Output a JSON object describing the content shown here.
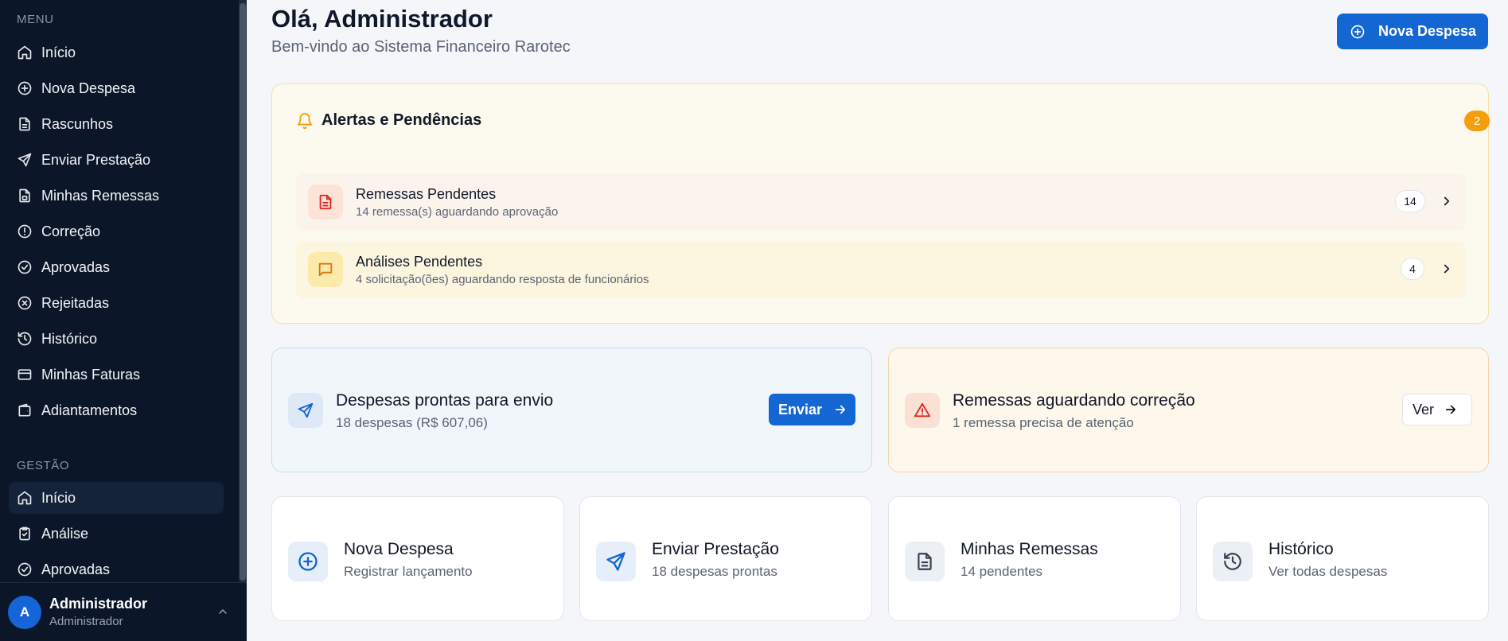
{
  "sidebar": {
    "menu_title": "MENU",
    "menu_items": [
      {
        "label": "Início",
        "icon": "home-icon"
      },
      {
        "label": "Nova Despesa",
        "icon": "plus-circle-icon"
      },
      {
        "label": "Rascunhos",
        "icon": "document-icon"
      },
      {
        "label": "Enviar Prestação",
        "icon": "send-icon"
      },
      {
        "label": "Minhas Remessas",
        "icon": "file-lock-icon"
      },
      {
        "label": "Correção",
        "icon": "alert-circle-icon"
      },
      {
        "label": "Aprovadas",
        "icon": "check-circle-icon"
      },
      {
        "label": "Rejeitadas",
        "icon": "x-circle-icon"
      },
      {
        "label": "Histórico",
        "icon": "history-icon"
      },
      {
        "label": "Minhas Faturas",
        "icon": "credit-card-icon"
      },
      {
        "label": "Adiantamentos",
        "icon": "wallet-icon"
      }
    ],
    "gestao_title": "GESTÃO",
    "gestao_items": [
      {
        "label": "Início",
        "icon": "home-icon",
        "active": true
      },
      {
        "label": "Análise",
        "icon": "clipboard-check-icon"
      },
      {
        "label": "Aprovadas",
        "icon": "check-circle-icon"
      }
    ],
    "user": {
      "initial": "A",
      "name": "Administrador",
      "role": "Administrador"
    }
  },
  "header": {
    "greeting": "Olá, Administrador",
    "subtitle": "Bem-vindo ao Sistema Financeiro Rarotec",
    "new_expense_button": "Nova Despesa"
  },
  "alerts": {
    "title": "Alertas e Pendências",
    "badge": "2",
    "items": [
      {
        "title": "Remessas Pendentes",
        "description": "14 remessa(s) aguardando aprovação",
        "count": "14"
      },
      {
        "title": "Análises Pendentes",
        "description": "4 solicitação(ões) aguardando resposta de funcionários",
        "count": "4"
      }
    ]
  },
  "ready_card": {
    "title": "Despesas prontas para envio",
    "description": "18 despesas (R$ 607,06)",
    "button": "Enviar"
  },
  "correction_card": {
    "title": "Remessas aguardando correção",
    "description": "1 remessa precisa de atenção",
    "button": "Ver"
  },
  "quick_actions": [
    {
      "title": "Nova Despesa",
      "description": "Registrar lançamento",
      "icon": "plus-circle-icon"
    },
    {
      "title": "Enviar Prestação",
      "description": "18 despesas prontas",
      "icon": "send-icon"
    },
    {
      "title": "Minhas Remessas",
      "description": "14 pendentes",
      "icon": "document-icon"
    },
    {
      "title": "Histórico",
      "description": "Ver todas despesas",
      "icon": "history-icon"
    }
  ],
  "colors": {
    "sidebar_bg": "#0b1628",
    "primary": "#1466d2",
    "alert_orange": "#f59e0b",
    "danger": "#dc2626"
  }
}
